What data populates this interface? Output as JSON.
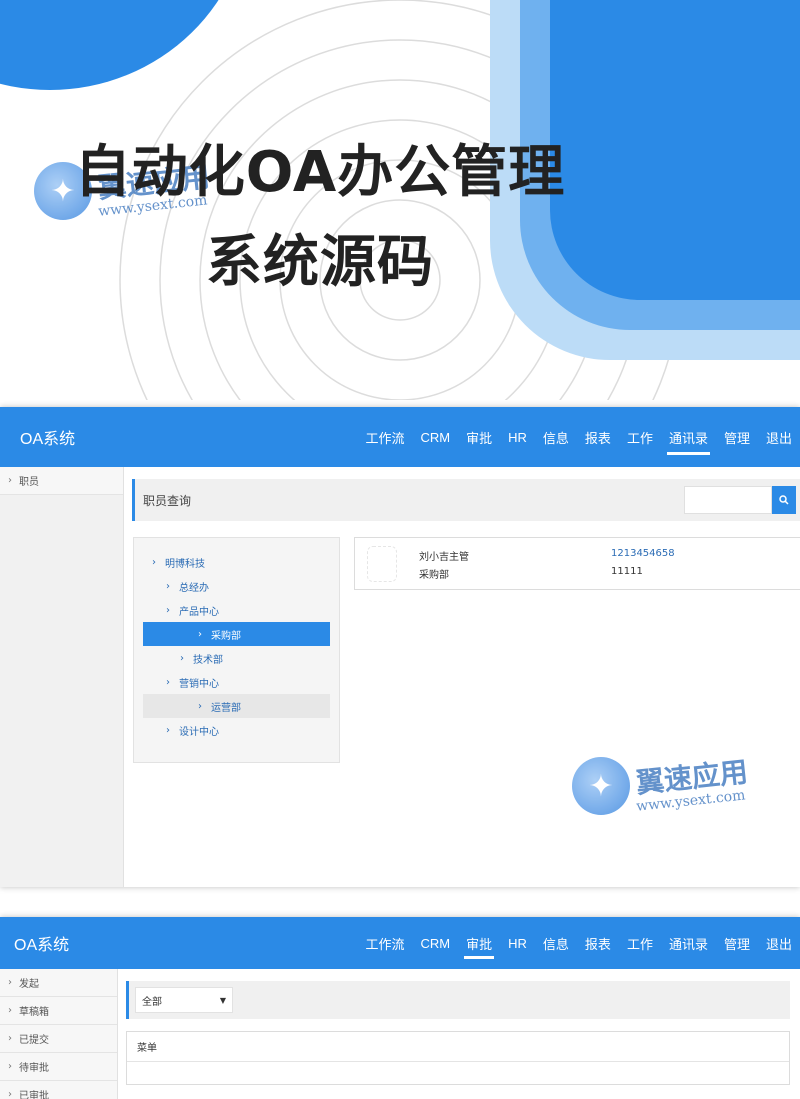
{
  "hero": {
    "title_line1": "自动化OA办公管理",
    "title_line2": "系统源码"
  },
  "watermark": {
    "cn": "翼速应用",
    "en": "www.ysext.com"
  },
  "colors": {
    "primary": "#2b8ae6",
    "link": "#2b6cb5",
    "sidebar_bg": "#f1f1f1"
  },
  "panel1": {
    "brand": "OA系统",
    "nav": [
      {
        "label": "工作流",
        "active": false
      },
      {
        "label": "CRM",
        "active": false
      },
      {
        "label": "审批",
        "active": false
      },
      {
        "label": "HR",
        "active": false
      },
      {
        "label": "信息",
        "active": false
      },
      {
        "label": "报表",
        "active": false
      },
      {
        "label": "工作",
        "active": false
      },
      {
        "label": "通讯录",
        "active": true
      },
      {
        "label": "管理",
        "active": false
      },
      {
        "label": "退出",
        "active": false
      }
    ],
    "sidebar": [
      {
        "label": "职员"
      }
    ],
    "query_title": "职员查询",
    "search": {
      "value": "",
      "placeholder": "",
      "icon": "search-icon"
    },
    "tree": [
      {
        "label": "明博科技",
        "level": 0,
        "state": ""
      },
      {
        "label": "总经办",
        "level": 1,
        "state": ""
      },
      {
        "label": "产品中心",
        "level": 1,
        "state": ""
      },
      {
        "label": "采购部",
        "level": 2,
        "state": "selected"
      },
      {
        "label": "技术部",
        "level": 2,
        "state": ""
      },
      {
        "label": "营销中心",
        "level": 1,
        "state": ""
      },
      {
        "label": "运营部",
        "level": 2,
        "state": "hover"
      },
      {
        "label": "设计中心",
        "level": 1,
        "state": ""
      }
    ],
    "employee": {
      "name": "刘小吉主管",
      "dept": "采购部",
      "phone": "1213454658",
      "ext": "11111"
    }
  },
  "panel2": {
    "brand": "OA系统",
    "nav": [
      {
        "label": "工作流",
        "active": false
      },
      {
        "label": "CRM",
        "active": false
      },
      {
        "label": "审批",
        "active": true
      },
      {
        "label": "HR",
        "active": false
      },
      {
        "label": "信息",
        "active": false
      },
      {
        "label": "报表",
        "active": false
      },
      {
        "label": "工作",
        "active": false
      },
      {
        "label": "通讯录",
        "active": false
      },
      {
        "label": "管理",
        "active": false
      },
      {
        "label": "退出",
        "active": false
      }
    ],
    "sidebar": [
      {
        "label": "发起"
      },
      {
        "label": "草稿箱"
      },
      {
        "label": "已提交"
      },
      {
        "label": "待审批"
      },
      {
        "label": "已审批"
      }
    ],
    "filter": {
      "selected": "全部"
    },
    "table": {
      "header": "菜单"
    }
  }
}
